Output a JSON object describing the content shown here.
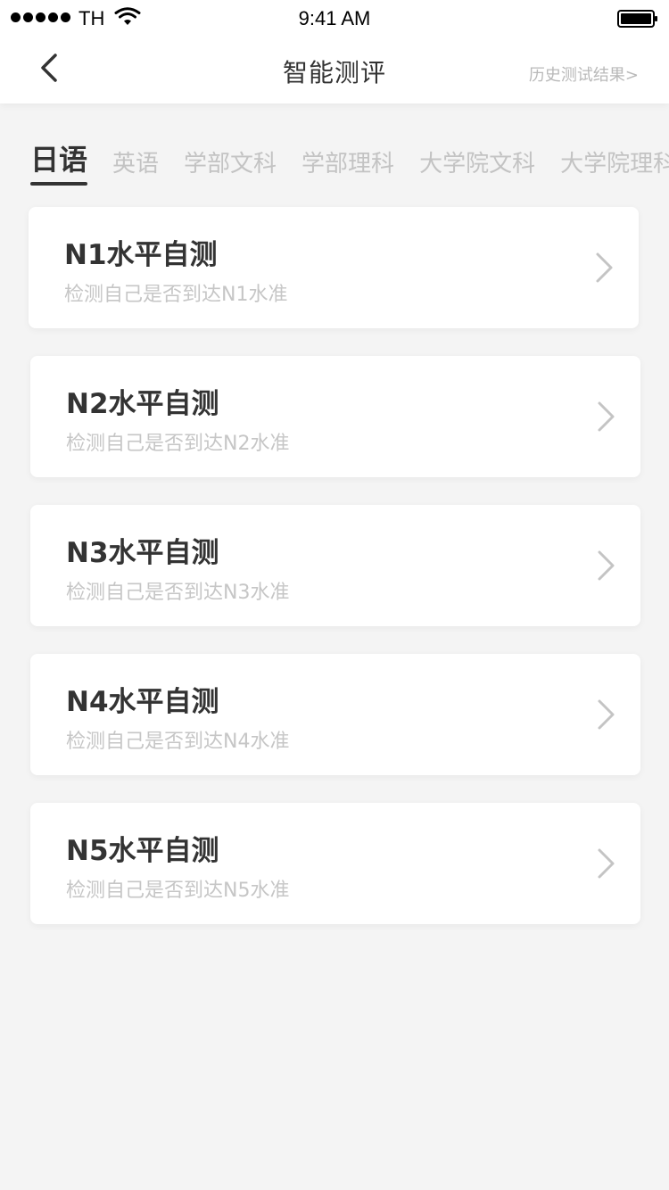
{
  "status_bar": {
    "carrier": "TH",
    "time": "9:41 AM"
  },
  "nav": {
    "title": "智能测评",
    "history_link": "历史测试结果>"
  },
  "tabs": [
    {
      "label": "日语",
      "active": true
    },
    {
      "label": "英语",
      "active": false
    },
    {
      "label": "学部文科",
      "active": false
    },
    {
      "label": "学部理科",
      "active": false
    },
    {
      "label": "大学院文科",
      "active": false
    },
    {
      "label": "大学院理科",
      "active": false
    }
  ],
  "cards": [
    {
      "title": "N1水平自测",
      "subtitle": "检测自己是否到达N1水准"
    },
    {
      "title": "N2水平自测",
      "subtitle": "检测自己是否到达N2水准"
    },
    {
      "title": "N3水平自测",
      "subtitle": "检测自己是否到达N3水准"
    },
    {
      "title": "N4水平自测",
      "subtitle": "检测自己是否到达N4水准"
    },
    {
      "title": "N5水平自测",
      "subtitle": "检测自己是否到达N5水准"
    }
  ],
  "colors": {
    "background": "#f4f4f4",
    "card": "#ffffff",
    "title_text": "#333333",
    "muted_text": "#c6c6c6"
  }
}
